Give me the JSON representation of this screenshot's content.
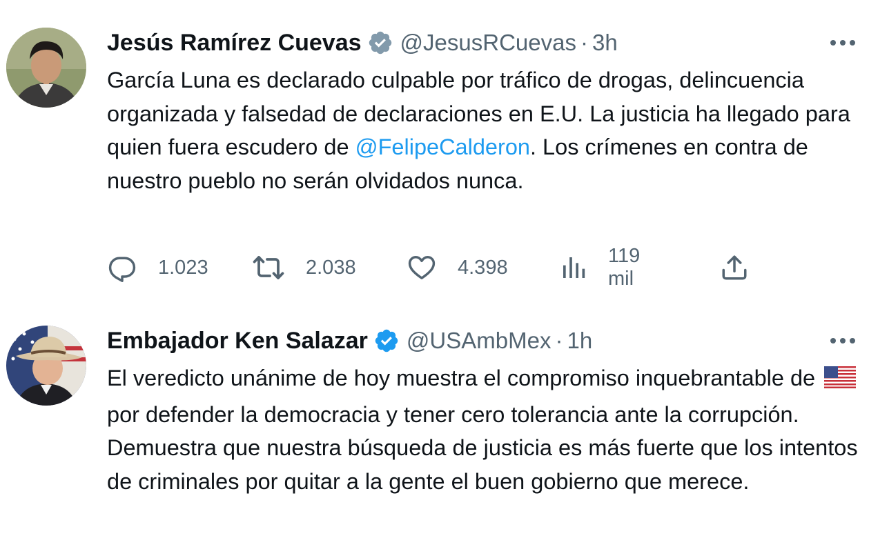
{
  "tweets": [
    {
      "author_name": "Jesús Ramírez Cuevas",
      "handle": "@JesusRCuevas",
      "separator": "·",
      "time": "3h",
      "verified_badge": "gray-verified-icon",
      "text_parts": [
        "García Luna es declarado culpable por tráfico de drogas, delincuencia organizada y falsedad de declaraciones en E.U. La justicia ha llegado para quien fuera escudero de ",
        "@FelipeCalderon",
        ". Los crímenes en contra de nuestro pueblo no serán olvidados nunca."
      ],
      "actions": {
        "replies": "1.023",
        "retweets": "2.038",
        "likes": "4.398",
        "views": "119 mil"
      }
    },
    {
      "author_name": "Embajador Ken Salazar",
      "handle": "@USAmbMex",
      "separator": "·",
      "time": "1h",
      "verified_badge": "blue-verified-icon",
      "text_parts": [
        "El veredicto unánime de hoy muestra el compromiso inquebrantable de ",
        " por defender la democracia y tener cero tolerancia ante la corrupción. Demuestra que nuestra búsqueda de justicia es más fuerte que los intentos de criminales por quitar a la gente el buen gobierno que merece."
      ],
      "inline_emoji": "us-flag-icon"
    }
  ],
  "colors": {
    "text": "#0f1419",
    "secondary": "#536471",
    "link": "#1d9bf0",
    "blue_badge": "#1d9bf0",
    "gray_badge": "#829aab"
  }
}
